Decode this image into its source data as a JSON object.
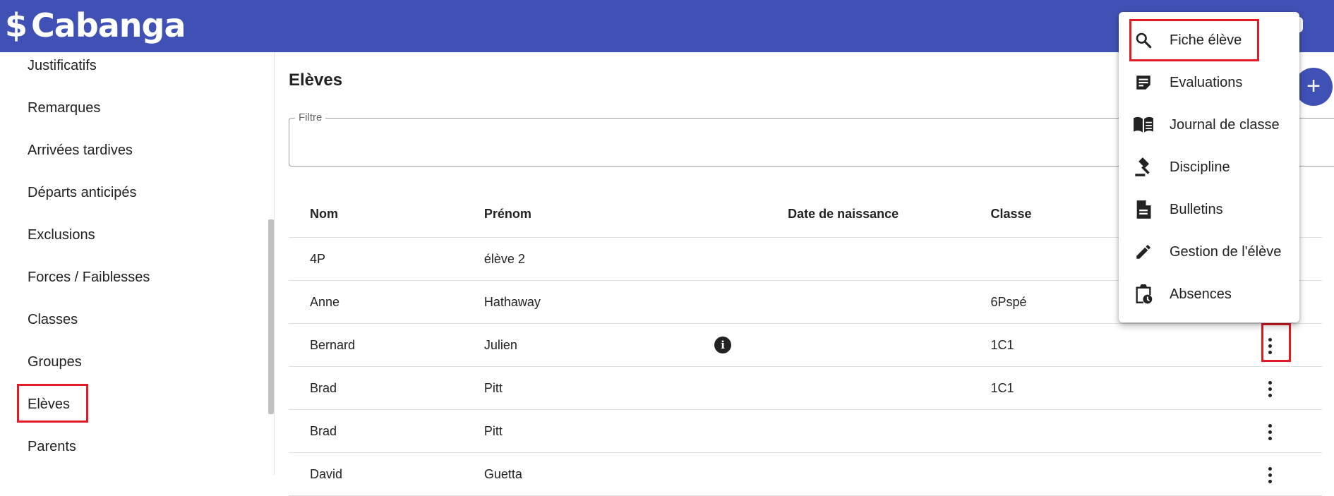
{
  "app": {
    "logo_symbol": "$",
    "logo_text": "Cabanga",
    "brand_color": "#3f51b5",
    "highlight_color": "#e01b24"
  },
  "sidebar": {
    "items": [
      {
        "label": "Justificatifs"
      },
      {
        "label": "Remarques"
      },
      {
        "label": "Arrivées tardives"
      },
      {
        "label": "Départs anticipés"
      },
      {
        "label": "Exclusions"
      },
      {
        "label": "Forces / Faiblesses"
      },
      {
        "label": "Classes"
      },
      {
        "label": "Groupes"
      },
      {
        "label": "Elèves",
        "highlighted": true
      },
      {
        "label": "Parents"
      }
    ]
  },
  "main": {
    "title": "Elèves",
    "filter": {
      "legend": "Filtre",
      "value": ""
    },
    "add_button_icon": "plus-icon",
    "table": {
      "headers": [
        "Nom",
        "Prénom",
        "Date de naissance",
        "Classe"
      ],
      "rows": [
        {
          "nom": "4P",
          "prenom": "élève 2",
          "naissance": "",
          "classe": ""
        },
        {
          "nom": "Anne",
          "prenom": "Hathaway",
          "naissance": "",
          "classe": "6Pspé"
        },
        {
          "nom": "Bernard",
          "prenom": "Julien",
          "naissance": "",
          "classe": "1C1",
          "has_info": true,
          "menu_open": true
        },
        {
          "nom": "Brad",
          "prenom": "Pitt",
          "naissance": "",
          "classe": "1C1"
        },
        {
          "nom": "Brad",
          "prenom": "Pitt",
          "naissance": "",
          "classe": ""
        },
        {
          "nom": "David",
          "prenom": "Guetta",
          "naissance": "",
          "classe": ""
        }
      ]
    }
  },
  "context_menu": {
    "items": [
      {
        "label": "Fiche élève",
        "icon": "search-icon",
        "highlighted": true
      },
      {
        "label": "Evaluations",
        "icon": "note-icon"
      },
      {
        "label": "Journal de classe",
        "icon": "book-icon"
      },
      {
        "label": "Discipline",
        "icon": "gavel-icon"
      },
      {
        "label": "Bulletins",
        "icon": "document-icon"
      },
      {
        "label": "Gestion de l'élève",
        "icon": "pencil-icon"
      },
      {
        "label": "Absences",
        "icon": "clipboard-clock-icon"
      }
    ]
  }
}
